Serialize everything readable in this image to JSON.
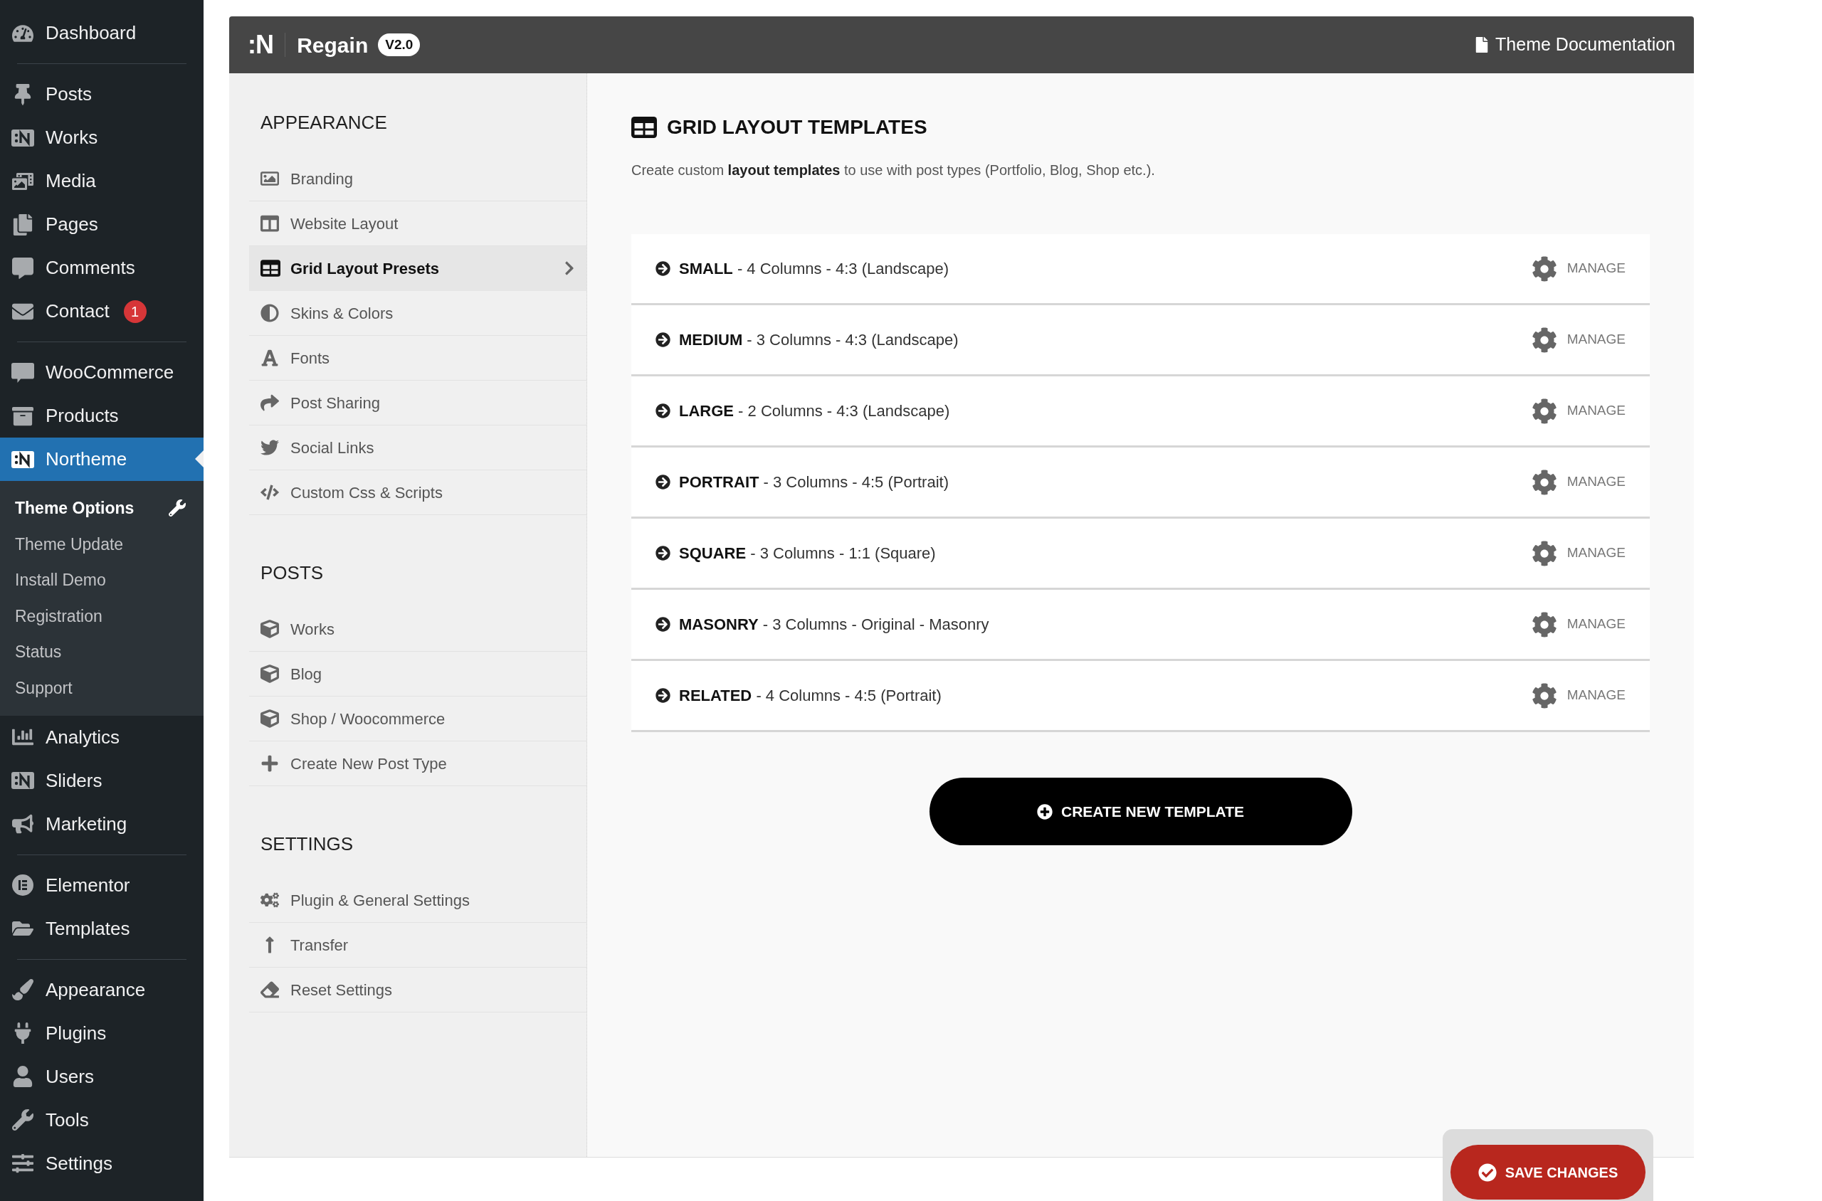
{
  "admin_menu": {
    "groups": [
      {
        "items": [
          {
            "label": "Dashboard",
            "selected": false
          }
        ]
      },
      {
        "items": [
          {
            "label": "Posts",
            "selected": false
          },
          {
            "label": "Works",
            "selected": false
          },
          {
            "label": "Media",
            "selected": false
          },
          {
            "label": "Pages",
            "selected": false
          },
          {
            "label": "Comments",
            "selected": false
          },
          {
            "label": "Contact",
            "selected": false,
            "badge": "1"
          }
        ]
      },
      {
        "items": [
          {
            "label": "WooCommerce",
            "selected": false
          },
          {
            "label": "Products",
            "selected": false
          },
          {
            "label": "Northeme",
            "selected": true
          }
        ]
      },
      {
        "items": [
          {
            "label": "Analytics",
            "selected": false
          },
          {
            "label": "Sliders",
            "selected": false
          },
          {
            "label": "Marketing",
            "selected": false
          }
        ]
      },
      {
        "items": [
          {
            "label": "Elementor",
            "selected": false
          },
          {
            "label": "Templates",
            "selected": false
          }
        ]
      },
      {
        "items": [
          {
            "label": "Appearance",
            "selected": false
          },
          {
            "label": "Plugins",
            "selected": false
          },
          {
            "label": "Users",
            "selected": false
          },
          {
            "label": "Tools",
            "selected": false
          },
          {
            "label": "Settings",
            "selected": false
          }
        ]
      }
    ],
    "submenu": [
      {
        "label": "Theme Options",
        "selected": true
      },
      {
        "label": "Theme Update",
        "selected": false
      },
      {
        "label": "Install Demo",
        "selected": false
      },
      {
        "label": "Registration",
        "selected": false
      },
      {
        "label": "Status",
        "selected": false
      },
      {
        "label": "Support",
        "selected": false
      }
    ]
  },
  "header": {
    "logo": ":N",
    "title": "Regain",
    "version": "V2.0",
    "doc_link": "Theme Documentation"
  },
  "options_nav": {
    "sections": [
      {
        "title": "APPEARANCE",
        "items": [
          {
            "label": "Branding",
            "selected": false
          },
          {
            "label": "Website Layout",
            "selected": false
          },
          {
            "label": "Grid Layout Presets",
            "selected": true
          },
          {
            "label": "Skins & Colors",
            "selected": false
          },
          {
            "label": "Fonts",
            "selected": false
          },
          {
            "label": "Post Sharing",
            "selected": false
          },
          {
            "label": "Social Links",
            "selected": false
          },
          {
            "label": "Custom Css & Scripts",
            "selected": false
          }
        ]
      },
      {
        "title": "POSTS",
        "items": [
          {
            "label": "Works",
            "selected": false
          },
          {
            "label": "Blog",
            "selected": false
          },
          {
            "label": "Shop / Woocommerce",
            "selected": false
          },
          {
            "label": "Create New Post Type",
            "selected": false
          }
        ]
      },
      {
        "title": "SETTINGS",
        "items": [
          {
            "label": "Plugin & General Settings",
            "selected": false
          },
          {
            "label": "Transfer",
            "selected": false
          },
          {
            "label": "Reset Settings",
            "selected": false
          }
        ]
      }
    ]
  },
  "content": {
    "title": "GRID LAYOUT TEMPLATES",
    "description": "Create custom **layout templates** to use with post types (Portfolio, Blog, Shop etc.).",
    "templates": [
      {
        "text": "**SMALL** - 4 Columns - 4:3 (Landscape)",
        "action": "MANAGE"
      },
      {
        "text": "**MEDIUM** - 3 Columns - 4:3 (Landscape)",
        "action": "MANAGE"
      },
      {
        "text": "**LARGE** - 2 Columns - 4:3 (Landscape)",
        "action": "MANAGE"
      },
      {
        "text": "**PORTRAIT** - 3 Columns - 4:5 (Portrait)",
        "action": "MANAGE"
      },
      {
        "text": "**SQUARE** - 3 Columns - 1:1 (Square)",
        "action": "MANAGE"
      },
      {
        "text": "**MASONRY** - 3 Columns - Original - Masonry",
        "action": "MANAGE"
      },
      {
        "text": "**RELATED** - 4 Columns - 4:5 (Portrait)",
        "action": "MANAGE"
      }
    ],
    "create_button": "CREATE NEW TEMPLATE"
  },
  "save_button": "SAVE CHANGES"
}
